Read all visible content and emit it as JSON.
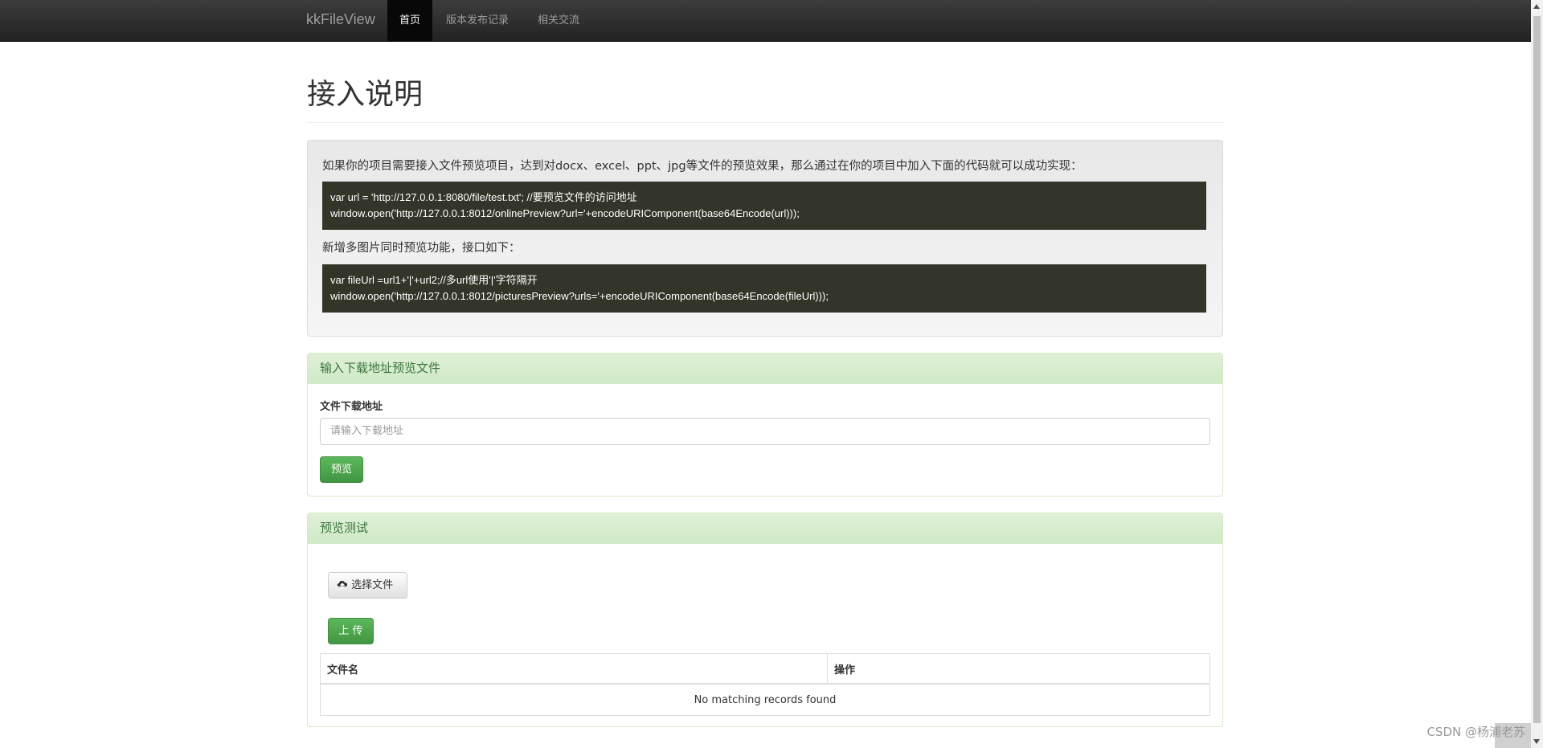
{
  "nav": {
    "brand": "kkFileView",
    "items": [
      {
        "label": "首页",
        "active": true
      },
      {
        "label": "版本发布记录",
        "active": false
      },
      {
        "label": "相关交流",
        "active": false
      }
    ]
  },
  "page": {
    "title": "接入说明"
  },
  "intro": {
    "text1": "如果你的项目需要接入文件预览项目，达到对docx、excel、ppt、jpg等文件的预览效果，那么通过在你的项目中加入下面的代码就可以成功实现：",
    "code1_line1": "var url = 'http://127.0.0.1:8080/file/test.txt'; //要预览文件的访问地址",
    "code1_line2": "window.open('http://127.0.0.1:8012/onlinePreview?url='+encodeURIComponent(base64Encode(url)));",
    "text2": "新增多图片同时预览功能，接口如下：",
    "code2_line1": "var fileUrl =url1+'|'+url2;//多url使用'|'字符隔开",
    "code2_line2": "window.open('http://127.0.0.1:8012/picturesPreview?urls='+encodeURIComponent(base64Encode(fileUrl)));"
  },
  "download_panel": {
    "heading": "输入下载地址预览文件",
    "label": "文件下载地址",
    "placeholder": "请输入下载地址",
    "button": "预览"
  },
  "test_panel": {
    "heading": "预览测试",
    "choose_button": "选择文件",
    "upload_button": "上 传",
    "table": {
      "columns": [
        "文件名",
        "操作"
      ],
      "empty_text": "No matching records found"
    }
  },
  "watermark": "CSDN @杨浦老苏",
  "colors": {
    "navbar": "#222222",
    "success": "#5cb85c",
    "panel_heading": "#dff0d8",
    "panel_heading_text": "#3c763d",
    "code_bg": "#333528"
  },
  "icons": {
    "upload": "cloud-upload-icon"
  }
}
